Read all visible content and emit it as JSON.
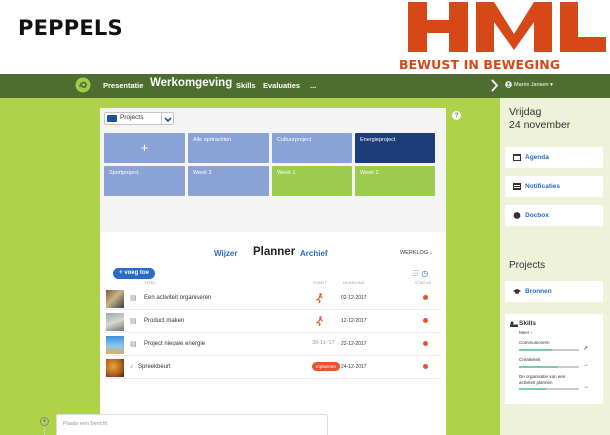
{
  "slide": {
    "title": "PEPPELS",
    "logo_text": "HML",
    "tagline": "BEWUST IN BEWEGING",
    "logo_color": "#d64817"
  },
  "nav": {
    "items": [
      "Presentatie",
      "Werkomgeving",
      "Skills",
      "Evaluaties",
      "..."
    ],
    "active": "Werkomgeving",
    "user": "Marrix Jansen ▾",
    "bar_color": "#4d6e2f"
  },
  "projects_select": {
    "label": "Projects"
  },
  "tiles": [
    {
      "label": "+",
      "kind": "add"
    },
    {
      "label": "Alle opdrachten",
      "kind": "blue"
    },
    {
      "label": "Cultuurproject",
      "kind": "blue"
    },
    {
      "label": "Energieproject",
      "kind": "dark"
    },
    {
      "label": "Sportproject",
      "kind": "blue"
    },
    {
      "label": "Week 3",
      "kind": "blue"
    },
    {
      "label": "Week 1",
      "kind": "green"
    },
    {
      "label": "Week 2",
      "kind": "green"
    }
  ],
  "tabs": {
    "wijzer": "Wijzer",
    "planner": "Planner",
    "archief": "Archief",
    "werklog_link": "WERKLOG ↓"
  },
  "planner": {
    "add_label": "+ voeg toe",
    "columns": {
      "title": "TITEL",
      "start": "START",
      "deadline": "DEADLINE",
      "status": "STATUS"
    },
    "rows": [
      {
        "title": "Een activiteit organiseren",
        "start": "",
        "deadline": "02-12-2017",
        "marker": "runner"
      },
      {
        "title": "Product maken",
        "start": "",
        "deadline": "12-12-2017",
        "marker": "runner"
      },
      {
        "title": "Project nieuwe energie",
        "start": "30-11-'17",
        "deadline": "22-12-2017",
        "marker": "none"
      },
      {
        "title": "Spreekbeurt",
        "start": "Inplannen",
        "deadline": "24-12-2017",
        "marker": "badge"
      }
    ],
    "status_color": "#e9532f"
  },
  "werklog": {
    "title": "Werklog",
    "placeholder": "Plaats een bericht"
  },
  "side": {
    "day": "Vrijdag",
    "date": "24 november",
    "cards": [
      {
        "label": "Agenda",
        "icon": "calendar-icon"
      },
      {
        "label": "Notificaties",
        "icon": "notifications-icon"
      },
      {
        "label": "Docbox",
        "icon": "docbox-icon"
      }
    ],
    "projects_heading": "Projects",
    "bronnen": "Bronnen",
    "skills": {
      "title": "Skills",
      "meer": "Meer ›",
      "items": [
        {
          "label": "Communiceren",
          "level": 0.55
        },
        {
          "label": "Creativiteit",
          "level": 0.65
        },
        {
          "label": "De organisatie van een activiteit plannen",
          "level": 0.45
        }
      ]
    }
  },
  "colors": {
    "app_bg": "#aed34b",
    "accent_blue": "#2a6bc7",
    "tile_dark": "#1c3d78"
  }
}
